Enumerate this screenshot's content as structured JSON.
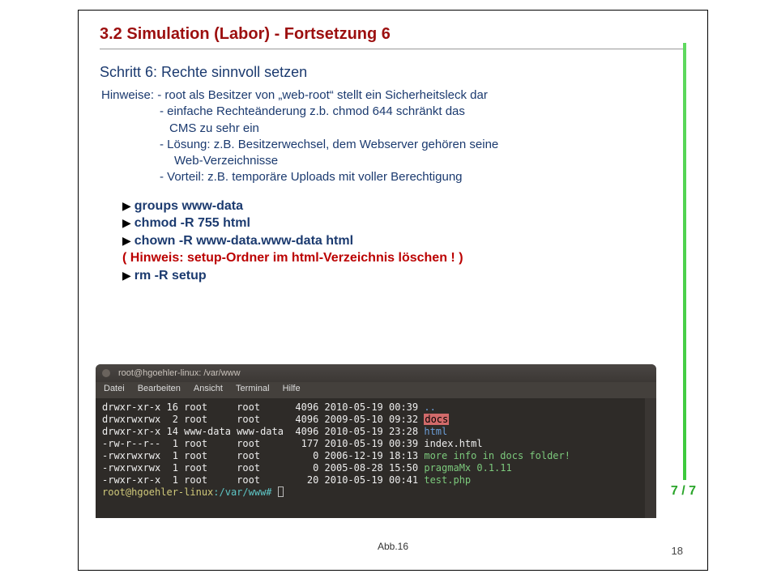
{
  "heading": "3.2 Simulation (Labor)  - Fortsetzung 6",
  "step": "Schritt 6: Rechte sinnvoll setzen",
  "hints": {
    "label": "Hinweise:",
    "l1": " - root als Besitzer von „web-root“ stellt ein Sicherheitsleck dar",
    "l2": "- einfache Rechteänderung z.b. chmod 644 schränkt das",
    "l3": "CMS zu sehr ein",
    "l4": "- Lösung: z.B. Besitzerwechsel, dem Webserver gehören seine",
    "l5": "Web-Verzeichnisse",
    "l6": "- Vorteil: z.B. temporäre Uploads mit voller Berechtigung"
  },
  "cmds": {
    "c1": "groups www-data",
    "c2": "chmod -R 755 html",
    "c3": " chown -R www-data.www-data html",
    "c4": "( Hinweis: setup-Ordner im html-Verzeichnis löschen ! )",
    "c5": "rm -R setup"
  },
  "terminal": {
    "title": "root@hgoehler-linux: /var/www",
    "menu": [
      "Datei",
      "Bearbeiten",
      "Ansicht",
      "Terminal",
      "Hilfe"
    ],
    "rows": [
      {
        "perm": "drwxr-xr-x",
        "n": "16",
        "own": "root",
        "grp": "root",
        "size": "4096",
        "date": "2010-05-19 00:39",
        "name": "..",
        "cls": "c-blue"
      },
      {
        "perm": "drwxrwxrwx",
        "n": "2",
        "own": "root",
        "grp": "root",
        "size": "4096",
        "date": "2009-05-10 09:32",
        "name": "docs",
        "cls": "hl"
      },
      {
        "perm": "drwxr-xr-x",
        "n": "14",
        "own": "www-data",
        "grp": "www-data",
        "size": "4096",
        "date": "2010-05-19 23:28",
        "name": "html",
        "cls": "c-blue"
      },
      {
        "perm": "-rw-r--r--",
        "n": "1",
        "own": "root",
        "grp": "root",
        "size": "177",
        "date": "2010-05-19 00:39",
        "name": "index.html",
        "cls": ""
      },
      {
        "perm": "-rwxrwxrwx",
        "n": "1",
        "own": "root",
        "grp": "root",
        "size": "0",
        "date": "2006-12-19 18:13",
        "name": "more info in docs folder!",
        "cls": "c-grn"
      },
      {
        "perm": "-rwxrwxrwx",
        "n": "1",
        "own": "root",
        "grp": "root",
        "size": "0",
        "date": "2005-08-28 15:50",
        "name": "pragmaMx 0.1.11",
        "cls": "c-grn"
      },
      {
        "perm": "-rwxr-xr-x",
        "n": "1",
        "own": "root",
        "grp": "root",
        "size": "20",
        "date": "2010-05-19 00:41",
        "name": "test.php",
        "cls": "c-grn"
      }
    ],
    "prompt_user": "root@hgoehler-linux",
    "prompt_path": ":/var/www#"
  },
  "abb": "Abb.16",
  "pagenum": "18",
  "seven": "7 / 7"
}
